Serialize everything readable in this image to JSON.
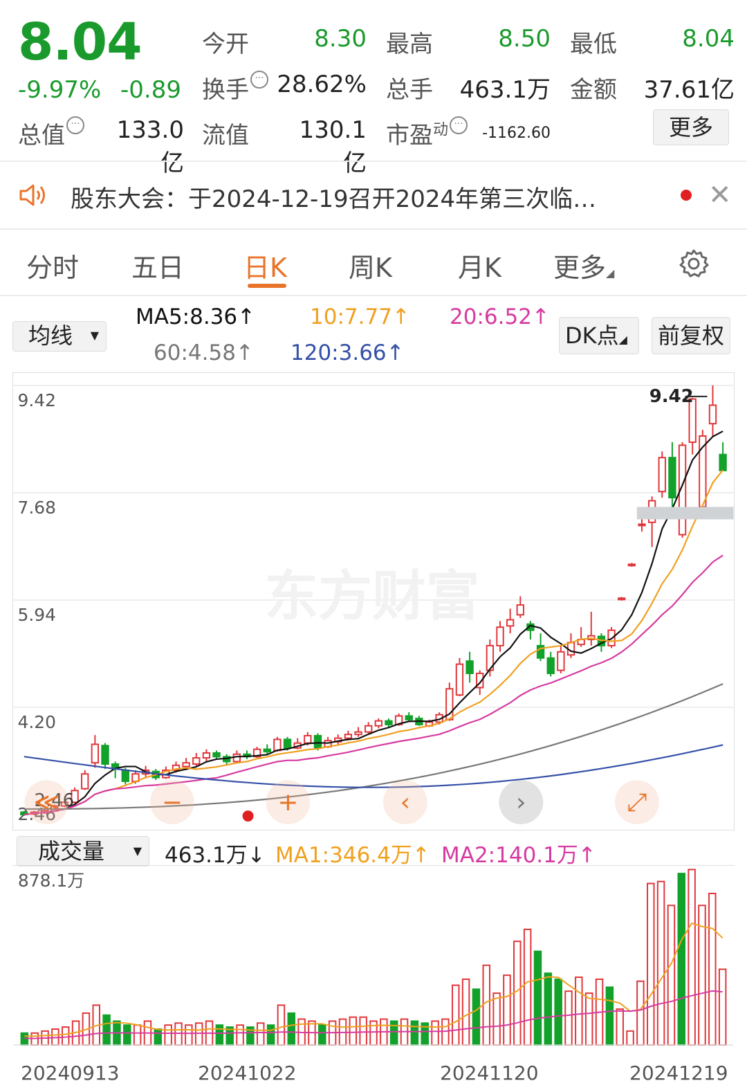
{
  "quote": {
    "price": "8.04",
    "change_pct": "-9.97%",
    "change_abs": "-0.89",
    "rows": [
      {
        "l1": "今开",
        "v1": "8.30",
        "l2": "最高",
        "v2": "8.50",
        "l3": "最低",
        "v3": "8.04"
      },
      {
        "l1": "换手",
        "v1": "28.62%",
        "l2": "总手",
        "v2": "463.1万",
        "l3": "金额",
        "v3": "37.61亿"
      },
      {
        "l1": "总值",
        "v1": "133.0亿",
        "l2": "流值",
        "v2": "130.1亿",
        "l3": "市盈",
        "v3": "-1162.60"
      }
    ],
    "pe_sup": "动",
    "more_label": "更多"
  },
  "notice": {
    "text": "股东大会：于2024-12-19召开2024年第三次临…"
  },
  "tabs": [
    "分时",
    "五日",
    "日K",
    "周K",
    "月K",
    "更多"
  ],
  "active_tab": 2,
  "ma": {
    "selector": "均线",
    "ma5": "MA5:8.36↑",
    "ma10": "10:7.77↑",
    "ma20": "20:6.52↑",
    "ma60": "60:4.58↑",
    "ma120": "120:3.66↑",
    "dk": "DK点",
    "fq": "前复权"
  },
  "price_axis": [
    "9.42",
    "7.68",
    "5.94",
    "4.20",
    "2.46"
  ],
  "high_marker": "9.42",
  "low_marker": "2.46",
  "watermark": "东方财富",
  "volume": {
    "selector": "成交量",
    "current": "463.1万↓",
    "ma1": "MA1:346.4万↑",
    "ma2": "MA2:140.1万↑",
    "max_label": "878.1万"
  },
  "dates": [
    "20240913",
    "20241022",
    "20241120",
    "20241219"
  ],
  "colors": {
    "up": "#e0363a",
    "down": "#12a12a",
    "ma5": "#111111",
    "ma10": "#f0a020",
    "ma20": "#d63aa0",
    "ma60": "#777777",
    "ma120": "#3550a8"
  },
  "chart_data": {
    "type": "candlestick",
    "ylim": [
      2.46,
      9.42
    ],
    "candles": [
      {
        "o": 2.5,
        "c": 2.46,
        "h": 2.52,
        "l": 2.44
      },
      {
        "o": 2.47,
        "c": 2.5,
        "h": 2.52,
        "l": 2.45
      },
      {
        "o": 2.49,
        "c": 2.52,
        "h": 2.55,
        "l": 2.47
      },
      {
        "o": 2.52,
        "c": 2.6,
        "h": 2.62,
        "l": 2.5
      },
      {
        "o": 2.6,
        "c": 2.66,
        "h": 2.7,
        "l": 2.58
      },
      {
        "o": 2.66,
        "c": 2.85,
        "h": 2.9,
        "l": 2.64
      },
      {
        "o": 2.88,
        "c": 3.12,
        "h": 3.18,
        "l": 2.86
      },
      {
        "o": 3.3,
        "c": 3.6,
        "h": 3.75,
        "l": 3.22
      },
      {
        "o": 3.58,
        "c": 3.28,
        "h": 3.62,
        "l": 3.2
      },
      {
        "o": 3.28,
        "c": 3.2,
        "h": 3.32,
        "l": 3.05
      },
      {
        "o": 3.18,
        "c": 3.0,
        "h": 3.22,
        "l": 2.95
      },
      {
        "o": 3.0,
        "c": 3.12,
        "h": 3.18,
        "l": 2.96
      },
      {
        "o": 3.12,
        "c": 3.18,
        "h": 3.25,
        "l": 3.05
      },
      {
        "o": 3.16,
        "c": 3.06,
        "h": 3.2,
        "l": 3.02
      },
      {
        "o": 3.06,
        "c": 3.18,
        "h": 3.24,
        "l": 3.04
      },
      {
        "o": 3.18,
        "c": 3.26,
        "h": 3.32,
        "l": 3.14
      },
      {
        "o": 3.24,
        "c": 3.3,
        "h": 3.38,
        "l": 3.18
      },
      {
        "o": 3.28,
        "c": 3.38,
        "h": 3.46,
        "l": 3.24
      },
      {
        "o": 3.38,
        "c": 3.46,
        "h": 3.52,
        "l": 3.32
      },
      {
        "o": 3.46,
        "c": 3.4,
        "h": 3.5,
        "l": 3.36
      },
      {
        "o": 3.4,
        "c": 3.32,
        "h": 3.44,
        "l": 3.26
      },
      {
        "o": 3.32,
        "c": 3.44,
        "h": 3.5,
        "l": 3.3
      },
      {
        "o": 3.44,
        "c": 3.4,
        "h": 3.5,
        "l": 3.36
      },
      {
        "o": 3.4,
        "c": 3.52,
        "h": 3.56,
        "l": 3.38
      },
      {
        "o": 3.52,
        "c": 3.48,
        "h": 3.6,
        "l": 3.44
      },
      {
        "o": 3.5,
        "c": 3.68,
        "h": 3.72,
        "l": 3.48
      },
      {
        "o": 3.68,
        "c": 3.54,
        "h": 3.72,
        "l": 3.5
      },
      {
        "o": 3.54,
        "c": 3.62,
        "h": 3.7,
        "l": 3.52
      },
      {
        "o": 3.62,
        "c": 3.74,
        "h": 3.8,
        "l": 3.58
      },
      {
        "o": 3.74,
        "c": 3.54,
        "h": 3.78,
        "l": 3.5
      },
      {
        "o": 3.56,
        "c": 3.66,
        "h": 3.72,
        "l": 3.54
      },
      {
        "o": 3.64,
        "c": 3.7,
        "h": 3.76,
        "l": 3.6
      },
      {
        "o": 3.7,
        "c": 3.76,
        "h": 3.82,
        "l": 3.66
      },
      {
        "o": 3.76,
        "c": 3.8,
        "h": 3.88,
        "l": 3.72
      },
      {
        "o": 3.8,
        "c": 3.9,
        "h": 3.96,
        "l": 3.78
      },
      {
        "o": 3.9,
        "c": 3.98,
        "h": 4.02,
        "l": 3.86
      },
      {
        "o": 3.98,
        "c": 3.92,
        "h": 4.02,
        "l": 3.88
      },
      {
        "o": 3.92,
        "c": 4.06,
        "h": 4.1,
        "l": 3.9
      },
      {
        "o": 4.06,
        "c": 4.0,
        "h": 4.12,
        "l": 3.96
      },
      {
        "o": 4.02,
        "c": 3.92,
        "h": 4.06,
        "l": 3.9
      },
      {
        "o": 3.9,
        "c": 3.96,
        "h": 4.0,
        "l": 3.88
      },
      {
        "o": 3.96,
        "c": 4.08,
        "h": 4.12,
        "l": 3.92
      },
      {
        "o": 4.0,
        "c": 4.5,
        "h": 4.6,
        "l": 3.98
      },
      {
        "o": 4.4,
        "c": 4.9,
        "h": 5.0,
        "l": 4.38
      },
      {
        "o": 4.95,
        "c": 4.75,
        "h": 5.1,
        "l": 4.6
      },
      {
        "o": 4.52,
        "c": 4.75,
        "h": 4.8,
        "l": 4.4
      },
      {
        "o": 4.8,
        "c": 5.2,
        "h": 5.3,
        "l": 4.7
      },
      {
        "o": 5.2,
        "c": 5.5,
        "h": 5.6,
        "l": 5.1
      },
      {
        "o": 5.52,
        "c": 5.62,
        "h": 5.8,
        "l": 5.4
      },
      {
        "o": 5.7,
        "c": 5.86,
        "h": 6.0,
        "l": 5.65
      },
      {
        "o": 5.55,
        "c": 5.45,
        "h": 5.6,
        "l": 5.3
      },
      {
        "o": 5.2,
        "c": 5.0,
        "h": 5.4,
        "l": 4.95
      },
      {
        "o": 5.0,
        "c": 4.75,
        "h": 5.1,
        "l": 4.7
      },
      {
        "o": 4.8,
        "c": 5.1,
        "h": 5.2,
        "l": 4.75
      },
      {
        "o": 5.05,
        "c": 5.25,
        "h": 5.4,
        "l": 5.0
      },
      {
        "o": 5.22,
        "c": 5.3,
        "h": 5.5,
        "l": 5.18
      },
      {
        "o": 5.3,
        "c": 5.36,
        "h": 5.75,
        "l": 5.2
      },
      {
        "o": 5.35,
        "c": 5.2,
        "h": 5.4,
        "l": 5.1
      },
      {
        "o": 5.2,
        "c": 5.45,
        "h": 5.5,
        "l": 5.16
      },
      {
        "o": 5.95,
        "c": 5.97,
        "h": 5.99,
        "l": 5.93
      },
      {
        "o": 6.5,
        "c": 6.52,
        "h": 6.54,
        "l": 6.48
      },
      {
        "o": 7.15,
        "c": 7.17,
        "h": 7.3,
        "l": 7.05
      },
      {
        "o": 7.2,
        "c": 7.55,
        "h": 7.62,
        "l": 6.8
      },
      {
        "o": 7.7,
        "c": 8.25,
        "h": 8.35,
        "l": 7.6
      },
      {
        "o": 8.25,
        "c": 7.6,
        "h": 8.5,
        "l": 7.4
      },
      {
        "o": 7.0,
        "c": 8.45,
        "h": 8.5,
        "l": 6.95
      },
      {
        "o": 8.5,
        "c": 9.2,
        "h": 9.22,
        "l": 8.3
      },
      {
        "o": 7.45,
        "c": 8.6,
        "h": 8.7,
        "l": 7.3
      },
      {
        "o": 8.8,
        "c": 9.1,
        "h": 9.42,
        "l": 8.6
      },
      {
        "o": 8.3,
        "c": 8.04,
        "h": 8.5,
        "l": 8.04
      }
    ],
    "ma5_end": 8.36,
    "ma10_end": 7.77,
    "ma20_end": 6.52,
    "ma60_end": 4.58,
    "ma120_end": 3.66,
    "volume_ylim": [
      0,
      878.1
    ],
    "volume": [
      60,
      60,
      70,
      80,
      90,
      120,
      160,
      200,
      150,
      120,
      100,
      100,
      120,
      80,
      100,
      110,
      100,
      110,
      120,
      100,
      90,
      100,
      90,
      110,
      100,
      200,
      160,
      130,
      120,
      100,
      120,
      130,
      140,
      140,
      120,
      130,
      120,
      130,
      120,
      110,
      120,
      130,
      300,
      330,
      280,
      400,
      260,
      350,
      520,
      580,
      470,
      360,
      330,
      270,
      340,
      260,
      330,
      290,
      180,
      70,
      320,
      810,
      820,
      700,
      860,
      880,
      700,
      760,
      380
    ]
  }
}
